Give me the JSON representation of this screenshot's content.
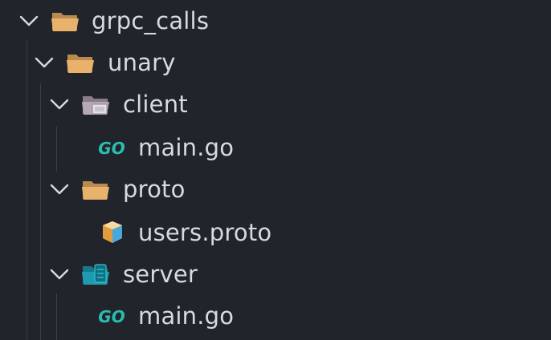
{
  "explorer": {
    "items": [
      {
        "label": "grpc_calls",
        "type": "folder",
        "expanded": true,
        "icon": "folder-open-icon"
      },
      {
        "label": "unary",
        "type": "folder",
        "expanded": true,
        "icon": "folder-open-icon"
      },
      {
        "label": "client",
        "type": "folder",
        "expanded": true,
        "icon": "client-folder-icon"
      },
      {
        "label": "main.go",
        "type": "file",
        "icon": "go-file-icon"
      },
      {
        "label": "proto",
        "type": "folder",
        "expanded": true,
        "icon": "folder-open-icon"
      },
      {
        "label": "users.proto",
        "type": "file",
        "icon": "proto-file-icon"
      },
      {
        "label": "server",
        "type": "folder",
        "expanded": true,
        "icon": "server-folder-icon"
      },
      {
        "label": "main.go",
        "type": "file",
        "icon": "go-file-icon"
      }
    ]
  },
  "colors": {
    "background": "#21252b",
    "text": "#d7dae0",
    "folder": "#e8b26c",
    "go": "#29beb0",
    "server_folder": "#1f9bb0",
    "indent_guide": "#3a3f47"
  }
}
